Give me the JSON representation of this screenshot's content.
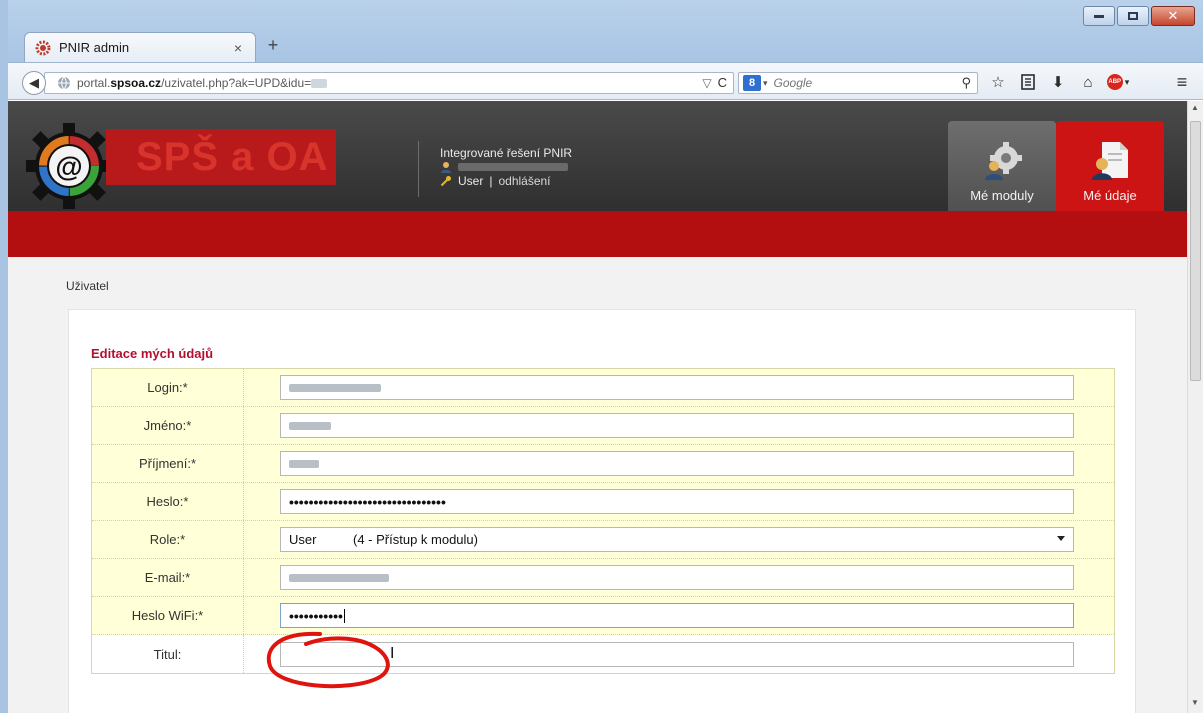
{
  "browser": {
    "tab_title": "PNIR admin",
    "tab_close": "×",
    "new_tab": "+",
    "url_prefix": "portal.",
    "url_domain": "spsoa.cz",
    "url_path": "/uzivatel.php?ak=UPD&idu=",
    "search_engine_badge": "8",
    "search_placeholder": "Google",
    "icons": [
      "back-icon",
      "globe-icon",
      "dropdown-icon",
      "reload-icon",
      "search-icon",
      "star-icon",
      "bookmarks-icon",
      "download-icon",
      "home-icon",
      "adblock-icon",
      "menu-icon"
    ]
  },
  "site": {
    "logo_text": "SPŠ a OA",
    "system_name": "Integrované řešení PNIR",
    "user_role": "User",
    "logout_link": "odhlášení",
    "separator": "|",
    "tiles": [
      {
        "label": "Mé moduly",
        "active": false
      },
      {
        "label": "Mé údaje",
        "active": true
      }
    ],
    "colors": {
      "accent_red": "#b30e10",
      "tile_active": "#cc1414",
      "label_red": "#b31030",
      "row_yellow": "#ffffd8"
    }
  },
  "content": {
    "breadcrumb": "Uživatel",
    "panel_title": "Editace mých údajů",
    "fields": [
      {
        "label": "Login:*",
        "type": "text",
        "value_hidden": true
      },
      {
        "label": "Jméno:*",
        "type": "text",
        "value_hidden": true
      },
      {
        "label": "Příjmení:*",
        "type": "text",
        "value_hidden": true
      },
      {
        "label": "Heslo:*",
        "type": "password",
        "mask": "••••••••••••••••••••••••••••••••"
      },
      {
        "label": "Role:*",
        "type": "select",
        "value": "User",
        "detail": "(4 - Přístup k modulu)"
      },
      {
        "label": "E-mail:*",
        "type": "text",
        "value_hidden": true
      },
      {
        "label": "Heslo WiFi:*",
        "type": "password",
        "mask": "•••••••••••",
        "focused": true
      },
      {
        "label": "Titul:",
        "type": "text",
        "value": ""
      }
    ]
  }
}
